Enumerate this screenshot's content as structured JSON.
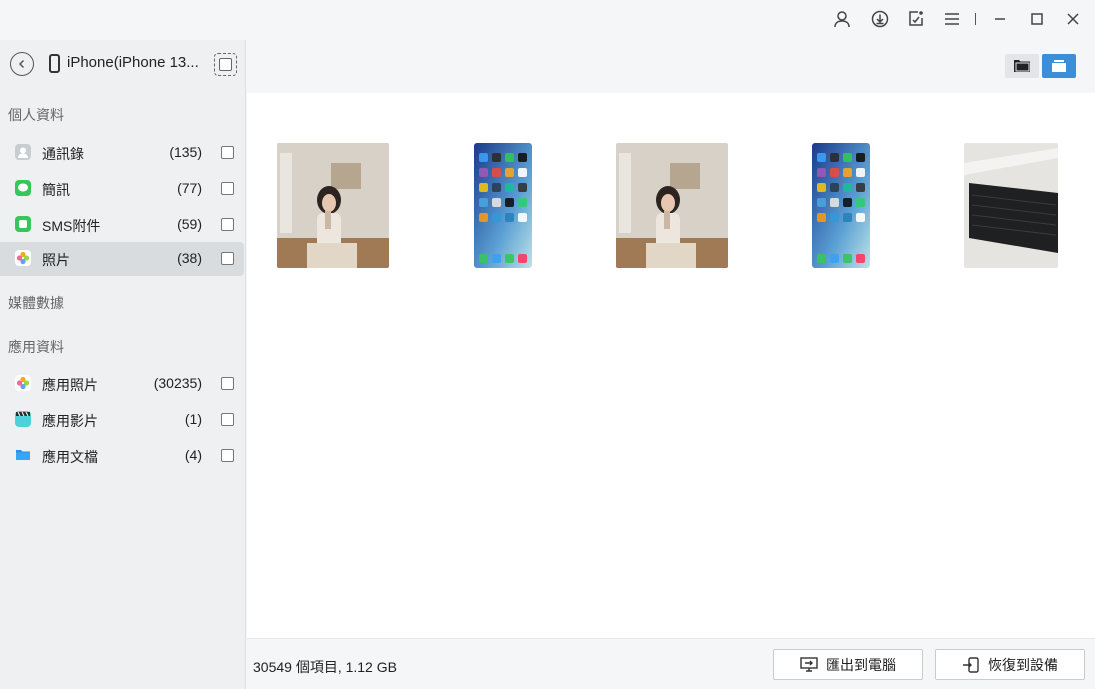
{
  "device": {
    "name": "iPhone(iPhone 13..."
  },
  "sidebar": {
    "sections": [
      {
        "title": "個人資料"
      },
      {
        "title": "媒體數據"
      },
      {
        "title": "應用資料"
      }
    ],
    "items": [
      {
        "label": "通訊錄",
        "count": "(135)",
        "icon": "contacts-icon"
      },
      {
        "label": "簡訊",
        "count": "(77)",
        "icon": "messages-icon"
      },
      {
        "label": "SMS附件",
        "count": "(59)",
        "icon": "sms-attachment-icon"
      },
      {
        "label": "照片",
        "count": "(38)",
        "icon": "photos-icon",
        "active": true
      },
      {
        "label": "應用照片",
        "count": "(30235)",
        "icon": "app-photos-icon"
      },
      {
        "label": "應用影片",
        "count": "(1)",
        "icon": "app-videos-icon"
      },
      {
        "label": "應用文檔",
        "count": "(4)",
        "icon": "app-documents-icon"
      }
    ]
  },
  "footer": {
    "summary": "30549 個項目, 1.12 GB",
    "export_label": "匯出到電腦",
    "restore_label": "恢復到設備"
  },
  "colors": {
    "accent": "#3b8fd9",
    "active_row": "#d9dcdf",
    "sidebar_bg": "#eef0f2"
  }
}
